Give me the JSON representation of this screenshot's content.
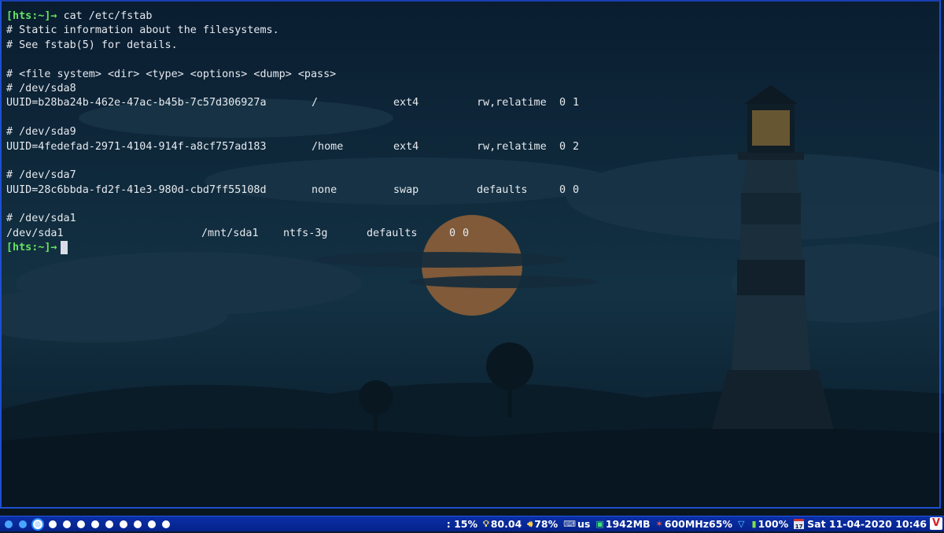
{
  "terminal": {
    "prompt": "[hts:~]→",
    "command": "cat /etc/fstab",
    "comments": [
      "# Static information about the filesystems.",
      "# See fstab(5) for details.",
      "",
      "# <file system> <dir> <type> <options> <dump> <pass>",
      "# /dev/sda8"
    ],
    "entries": [
      {
        "fs": "UUID=b28ba24b-462e-47ac-b45b-7c57d306927a",
        "dir": "/",
        "type": "ext4",
        "options": "rw,relatime",
        "dump": "0",
        "pass": "1"
      },
      {
        "comment": "# /dev/sda9",
        "fs": "UUID=4fedefad-2971-4104-914f-a8cf757ad183",
        "dir": "/home",
        "type": "ext4",
        "options": "rw,relatime",
        "dump": "0",
        "pass": "2"
      },
      {
        "comment": "# /dev/sda7",
        "fs": "UUID=28c6bbda-fd2f-41e3-980d-cbd7ff55108d",
        "dir": "none",
        "type": "swap",
        "options": "defaults",
        "dump": "0",
        "pass": "0"
      },
      {
        "comment": "# /dev/sda1",
        "fs": "/dev/sda1",
        "dir": "/mnt/sda1",
        "type": "ntfs-3g",
        "options": "defaults",
        "dump": "0",
        "pass": "0"
      }
    ]
  },
  "taskbar": {
    "status": {
      "disk": ": 15%",
      "load": "80.04",
      "volume": "78%",
      "keyboard": "us",
      "memory": "1942MB",
      "cpu": "600MHz65%",
      "battery": "100%",
      "datetime": "Sat 11-04-2020 10:46",
      "calendar_day": "17"
    },
    "logo_letter": "V"
  },
  "icons": {
    "disk": "disk-icon",
    "load": "lightbulb-icon",
    "volume": "speaker-icon",
    "keyboard": "keyboard-icon",
    "memory": "memory-icon",
    "cpu": "cpu-icon",
    "wifi": "wifi-icon",
    "battery": "battery-icon",
    "calendar": "calendar-icon"
  },
  "colors": {
    "prompt": "#66e35f",
    "terminal_text": "#e6e9ee",
    "taskbar": "#0a2fa6",
    "terminal_border": "#1f4fd1"
  }
}
